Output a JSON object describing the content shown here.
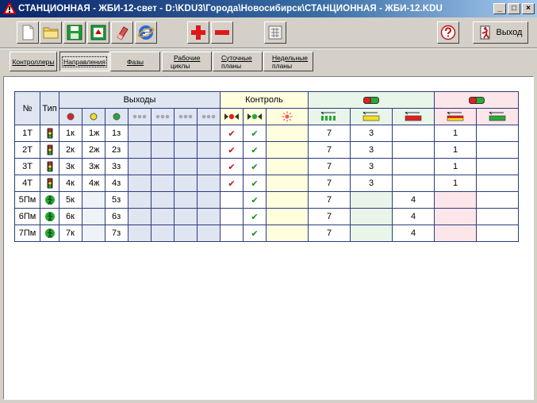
{
  "window": {
    "title": "СТАНЦИОННАЯ - ЖБИ-12-свет - D:\\KDU3\\Города\\Новосибирск\\СТАНЦИОННАЯ - ЖБИ-12.KDU",
    "minimize_label": "_",
    "maximize_label": "□",
    "close_label": "×"
  },
  "toolbar": {
    "buttons": [
      "new-file-icon",
      "open-folder-icon",
      "save-icon",
      "export-icon",
      "eraser-icon",
      "internet-explorer-icon",
      "add-icon",
      "remove-icon",
      "layout-icon",
      "help-icon"
    ],
    "exit_label": "Выход"
  },
  "tabs": [
    {
      "label": "Контроллеры"
    },
    {
      "label": "Направления",
      "active": true
    },
    {
      "label": "Фазы"
    },
    {
      "label_line1": "Рабочие",
      "label_line2": "циклы"
    },
    {
      "label_line1": "Суточные",
      "label_line2": "планы"
    },
    {
      "label_line1": "Недельные",
      "label_line2": "планы"
    }
  ],
  "table": {
    "headers": {
      "num": "№",
      "type": "Тип",
      "outputs": "Выходы",
      "control": "Контроль"
    },
    "rows": [
      {
        "num": "1Т",
        "type": "traffic-light",
        "o1": "1к",
        "o2": "1ж",
        "o3": "1з",
        "c1": "red",
        "c2": "green",
        "v1": "7",
        "v2": "3",
        "v3": "",
        "v4": "1",
        "v5": ""
      },
      {
        "num": "2Т",
        "type": "traffic-light",
        "o1": "2к",
        "o2": "2ж",
        "o3": "2з",
        "c1": "red",
        "c2": "green",
        "v1": "7",
        "v2": "3",
        "v3": "",
        "v4": "1",
        "v5": ""
      },
      {
        "num": "3Т",
        "type": "traffic-light",
        "o1": "3к",
        "o2": "3ж",
        "o3": "3з",
        "c1": "red",
        "c2": "green",
        "v1": "7",
        "v2": "3",
        "v3": "",
        "v4": "1",
        "v5": ""
      },
      {
        "num": "4Т",
        "type": "traffic-light",
        "o1": "4к",
        "o2": "4ж",
        "o3": "4з",
        "c1": "red",
        "c2": "green",
        "v1": "7",
        "v2": "3",
        "v3": "",
        "v4": "1",
        "v5": ""
      },
      {
        "num": "5Пм",
        "type": "pedestrian",
        "o1": "5к",
        "o2": "",
        "o3": "5з",
        "c1": "",
        "c2": "green",
        "v1": "7",
        "v2": "",
        "v3": "4",
        "v4": "",
        "v5": ""
      },
      {
        "num": "6Пм",
        "type": "pedestrian",
        "o1": "6к",
        "o2": "",
        "o3": "6з",
        "c1": "",
        "c2": "green",
        "v1": "7",
        "v2": "",
        "v3": "4",
        "v4": "",
        "v5": ""
      },
      {
        "num": "7Пм",
        "type": "pedestrian",
        "o1": "7к",
        "o2": "",
        "o3": "7з",
        "c1": "",
        "c2": "green",
        "v1": "7",
        "v2": "",
        "v3": "4",
        "v4": "",
        "v5": ""
      }
    ]
  },
  "colors": {
    "title_start": "#0a246a",
    "title_end": "#a6caf0",
    "grid_border": "#2c3c7c",
    "check_red": "#c0141e",
    "check_green": "#148c28"
  }
}
